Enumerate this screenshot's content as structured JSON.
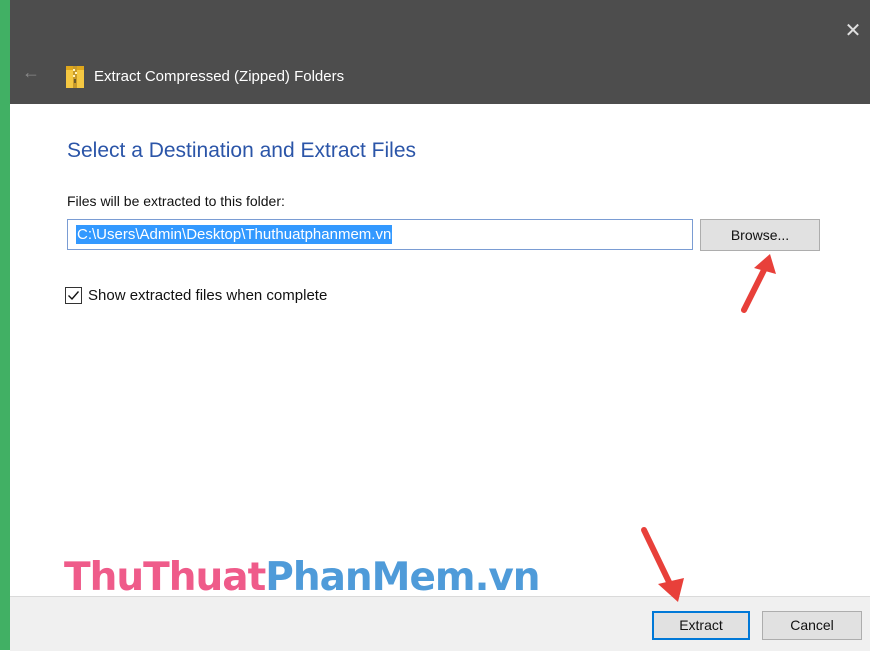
{
  "window": {
    "title": "Extract Compressed (Zipped) Folders",
    "close_glyph": "✕",
    "back_glyph": "←",
    "accent_border": "#41b064",
    "titlebar_color": "#4d4d4d"
  },
  "main": {
    "heading": "Select a Destination and Extract Files",
    "field_label": "Files will be extracted to this folder:",
    "destination_path": "C:\\Users\\Admin\\Desktop\\Thuthuatphanmem.vn",
    "browse_label": "Browse...",
    "checkbox_label": "Show extracted files when complete",
    "checkbox_checked": true
  },
  "footer": {
    "extract_label": "Extract",
    "cancel_label": "Cancel"
  },
  "watermark": {
    "part1": "ThuThuat",
    "part2": "PhanMem",
    "part3": ".vn"
  },
  "icons": {
    "title_icon": "zip-folder-icon",
    "annotation": "red-arrow-icon"
  },
  "colors": {
    "heading": "#2b55a8",
    "selection": "#3399ff",
    "annotation_arrow": "#e8403a"
  }
}
